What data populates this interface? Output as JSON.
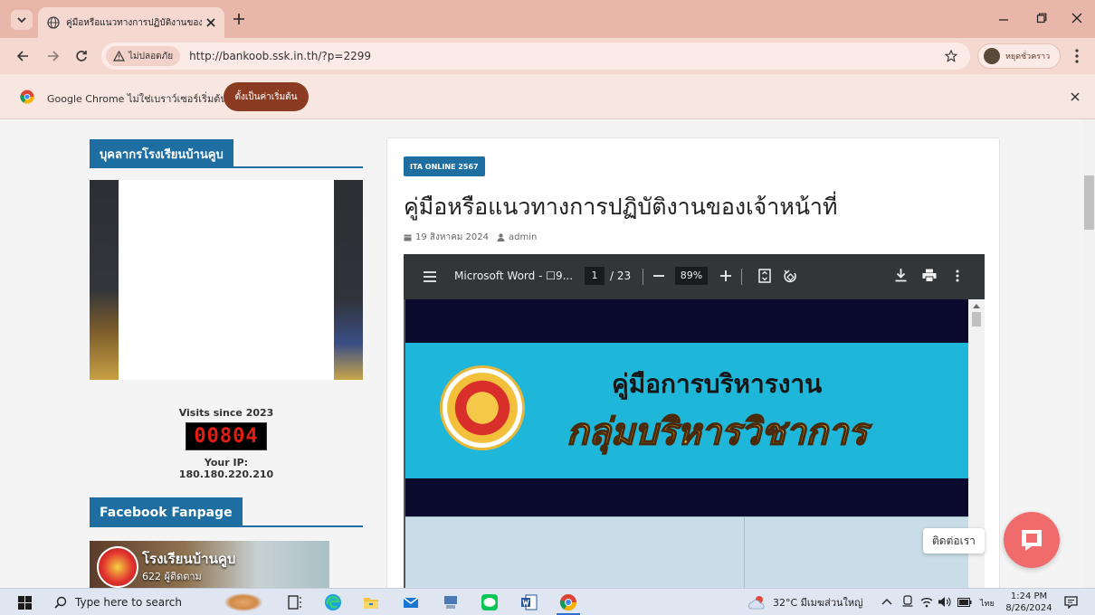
{
  "browser": {
    "tab_title": "คู่มือหรือแนวทางการปฏิบัติงานของเจ้า",
    "address": {
      "security_label": "ไม่ปลอดภัย",
      "url": "http://bankoob.ssk.in.th/?p=2299"
    },
    "profile_label": "หยุดชั่วคราว",
    "infobar": {
      "message": "Google Chrome ไม่ใช่เบราว์เซอร์เริ่มต้น",
      "button_label": "ตั้งเป็นค่าเริ่มต้น"
    }
  },
  "sidebar": {
    "staff_heading": "บุคลากรโรงเรียนบ้านคูบ",
    "visits_label": "Visits since 2023",
    "counter": "00804",
    "ip_label": "Your IP: 180.180.220.210",
    "fanpage_heading": "Facebook Fanpage",
    "fb_page_name": "โรงเรียนบ้านคูบ",
    "fb_followers": "622 ผู้ติดตาม"
  },
  "article": {
    "category": "ITA ONLINE 2567",
    "title": "คู่มือหรือแนวทางการปฏิบัติงานของเจ้าหน้าที่",
    "date": "19 สิงหาคม 2024",
    "author": "admin"
  },
  "pdf_viewer": {
    "doc_title": "Microsoft Word - ☐9...",
    "page_current": "1",
    "page_total": "/ 23",
    "zoom": "89%",
    "banner_title": "คู่มือการบริหารงาน",
    "banner_subtitle": "กลุ่มบริหารวิชาการ"
  },
  "contact_button_label": "ติดต่อเรา",
  "taskbar": {
    "search_placeholder": "Type here to search",
    "weather": "32°C มีเมฆส่วนใหญ่",
    "language": "ไทย",
    "time": "1:24 PM",
    "date": "8/26/2024"
  }
}
